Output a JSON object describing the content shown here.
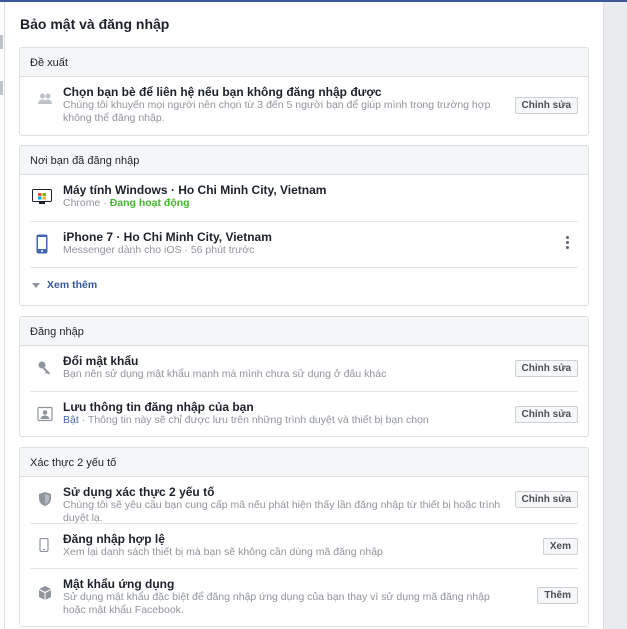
{
  "page": {
    "title": "Bảo mật và đăng nhập"
  },
  "recommended": {
    "header": "Đề xuất",
    "item": {
      "title": "Chọn bạn bè để liên hệ nếu bạn không đăng nhập được",
      "desc": "Chúng tôi khuyến mọi người nên chọn từ 3 đến 5 người bạn để giúp mình trong trường hợp không thể đăng nhập.",
      "button": "Chỉnh sửa",
      "icon": "friends-icon"
    }
  },
  "logins": {
    "header": "Nơi bạn đã đăng nhập",
    "items": [
      {
        "title": "Máy tính Windows · Ho Chi Minh City, Vietnam",
        "desc_prefix": "Chrome · ",
        "desc_status": "Đang hoạt động",
        "icon": "windows-computer-icon"
      },
      {
        "title": "iPhone 7 · Ho Chi Minh City, Vietnam",
        "desc": "Messenger dành cho iOS · 56 phút trước",
        "icon": "iphone-icon"
      }
    ],
    "see_more": "Xem thêm"
  },
  "login": {
    "header": "Đăng nhập",
    "items": [
      {
        "title": "Đổi mật khẩu",
        "desc": "Bạn nên sử dụng mật khẩu mạnh mà mình chưa sử dụng ở đâu khác",
        "button": "Chỉnh sửa",
        "icon": "key-icon"
      },
      {
        "title": "Lưu thông tin đăng nhập của bạn",
        "desc_status": "Bật",
        "desc_rest": " · Thông tin này sẽ chỉ được lưu trên những trình duyệt và thiết bị bạn chọn",
        "button": "Chỉnh sửa",
        "icon": "profile-card-icon"
      }
    ]
  },
  "two_factor": {
    "header": "Xác thực 2 yếu tố",
    "items": [
      {
        "title": "Sử dụng xác thực 2 yếu tố",
        "desc": "Chúng tôi sẽ yêu cầu bạn cung cấp mã nếu phát hiện thấy lần đăng nhập từ thiết bị hoặc trình duyệt lạ.",
        "button": "Chỉnh sửa",
        "icon": "shield-icon"
      },
      {
        "title": "Đăng nhập hợp lệ",
        "desc": "Xem lại danh sách thiết bị mà bạn sẽ không cần dùng mã đăng nhập",
        "button": "Xem",
        "icon": "phone-icon"
      },
      {
        "title": "Mật khẩu ứng dụng",
        "desc": "Sử dụng mật khẩu đặc biệt để đăng nhập ứng dụng của bạn thay vì sử dụng mã đăng nhập hoặc mật khẩu Facebook.",
        "button": "Thêm",
        "icon": "cube-icon"
      }
    ]
  },
  "colors": {
    "accent": "#4267b2",
    "active": "#42b72a",
    "muted": "#90949c"
  }
}
